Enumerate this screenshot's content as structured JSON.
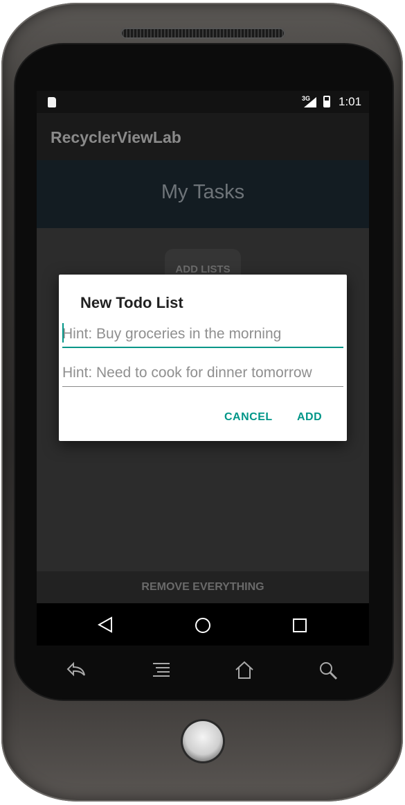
{
  "status_bar": {
    "network": "3G",
    "time": "1:01"
  },
  "app_bar": {
    "title": "RecyclerViewLab"
  },
  "header": {
    "title": "My Tasks"
  },
  "content": {
    "add_lists_label": "ADD LISTS",
    "remove_label": "REMOVE EVERYTHING"
  },
  "dialog": {
    "title": "New Todo List",
    "field1_text": "Hint: Buy groceries in the morning",
    "field2_text": "Hint: Need to cook for dinner tomorrow",
    "cancel_label": "CANCEL",
    "add_label": "ADD"
  },
  "colors": {
    "accent": "#009688",
    "dialog_bg": "#ffffff",
    "screen_bg": "#2c2c2c"
  },
  "icons": {
    "nav": [
      "back-triangle-icon",
      "home-circle-icon",
      "recents-square-icon"
    ],
    "hardware": [
      "back-arrow-icon",
      "menu-icon",
      "home-icon",
      "search-icon"
    ]
  }
}
